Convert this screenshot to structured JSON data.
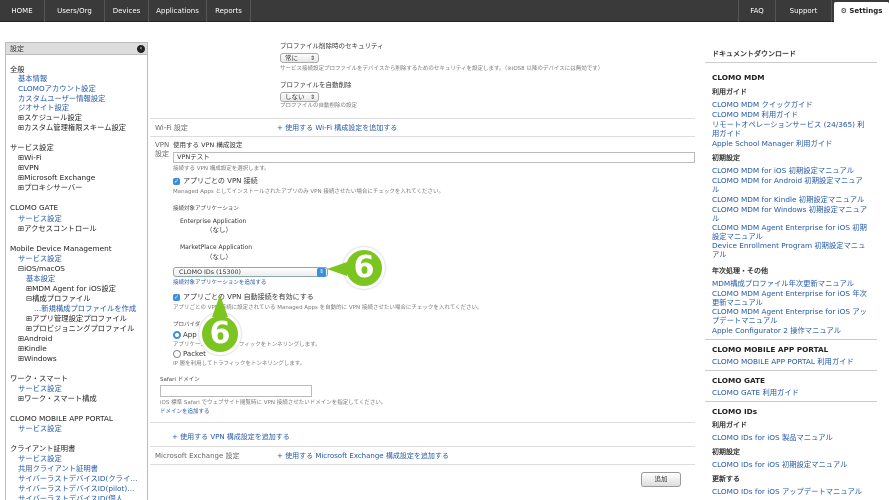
{
  "nav": {
    "home": "HOME",
    "users": "Users/Org",
    "devices": "Devices",
    "applications": "Applications",
    "reports": "Reports",
    "faq": "FAQ",
    "support": "Support",
    "settings": "Settings"
  },
  "sidebar": {
    "header": "設定",
    "items": [
      "全般",
      "基本情報",
      "CLOMOアカウント設定",
      "カスタムユーザー情報設定",
      "ジオサイト設定",
      "⊞スケジュール設定",
      "⊞カスタム管理権限スキーム設定",
      "サービス設定",
      "⊞Wi-Fi",
      "⊞VPN",
      "⊞Microsoft Exchange",
      "⊞プロキシサーバー",
      "CLOMO GATE",
      "サービス設定",
      "⊞アクセスコントロール",
      "Mobile Device Management",
      "サービス設定",
      "⊟iOS/macOS",
      "基本設定",
      "⊞MDM Agent for iOS設定",
      "⊟構成プロファイル",
      "…新規構成プロファイルを作成",
      "⊞アプリ管理設定プロファイル",
      "⊞プロビジョニングプロファイル",
      "⊞Android",
      "⊞Kindle",
      "⊞Windows",
      "ワーク・スマート",
      "サービス設定",
      "⊞ワーク・スマート構成",
      "CLOMO MOBILE APP PORTAL",
      "サービス設定",
      "クライアント証明書",
      "サービス設定",
      "共用クライアント証明書",
      "サイバーラストデバイスID(クライ…",
      "サイバーラストデバイスID(pilot)…",
      "サイバーラストデバイスID(個人…"
    ]
  },
  "main": {
    "removal_security_label": "プロファイル削除時のセキュリティ",
    "removal_security_value": "常に",
    "removal_security_note": "サービス接続設定プロファイルをデバイスから削除するためのセキュリティを設定します。（※iOS8 以降のデバイスには無効です）",
    "auto_remove_label": "プロファイルを自動削除",
    "auto_remove_value": "しない",
    "auto_remove_note": "プロファイルの自動削除の設定",
    "wifi_section": "Wi-Fi 設定",
    "wifi_add": "+ 使用する Wi-Fi 構成設定を追加する",
    "vpn_section": "VPN 設定",
    "vpn_config_label": "使用する VPN 構成設定",
    "vpn_config_value": "VPNテスト",
    "vpn_config_note": "接続する VPN 構成設定を選択します。",
    "per_app_vpn_label": "アプリごとの VPN 接続",
    "per_app_vpn_note": "Managed Apps としてインストールされたアプリのみ VPN 接続させたい場合にチェックを入れてください。",
    "target_apps_label": "接続対象アプリケーション",
    "enterprise_label": "Enterprise Application",
    "enterprise_value": "（なし）",
    "marketplace_label": "MarketPlace Application",
    "marketplace_value": "（なし）",
    "app_select_value": "CLOMO IDs (15300)",
    "add_target_app": "接続対象アプリケーションを追加する",
    "auto_connect_label": "アプリごとの VPN 自動接続を有効にする",
    "auto_connect_note": "アプリごとの VPN 接続に設定されている Managed Apps を自動的に VPN 接続させたい場合にチェックを入れてください。",
    "provider_label": "プロバイダ",
    "radio_app": "App",
    "radio_app_note": "アプリケーション層でトラフィックをトンネリングします。",
    "radio_packet": "Packet",
    "radio_packet_note": "IP 層を利用してトラフィックをトンネリングします。",
    "safari_label": "Safari ドメイン",
    "safari_note": "iOS 標準 Safari でウェブサイト閲覧時に VPN 接続させたいドメインを指定してください。",
    "add_domain": "ドメインを追加する",
    "vpn_add": "+ 使用する VPN 構成設定を追加する",
    "exchange_section": "Microsoft Exchange 設定",
    "exchange_add": "+ 使用する Microsoft Exchange 構成設定を追加する",
    "add_button": "追加"
  },
  "badges": {
    "top": "6",
    "bottom": "6"
  },
  "right": {
    "title": "ドキュメントダウンロード",
    "mdm": "CLOMO MDM",
    "usage_guide": "利用ガイド",
    "usage_links": [
      "CLOMO MDM クイックガイド",
      "CLOMO MDM 利用ガイド",
      "リモートオペレーションサービス (24/365) 利用ガイド",
      "Apple School Manager 利用ガイド"
    ],
    "initial": "初期設定",
    "initial_links": [
      "CLOMO MDM for iOS 初期設定マニュアル",
      "CLOMO MDM for Android 初期設定マニュアル",
      "CLOMO MDM for Kindle 初期設定マニュアル",
      "CLOMO MDM for Windows 初期設定マニュアル",
      "CLOMO MDM Agent Enterprise for iOS 初期設定マニュアル",
      "Device Enrollment Program 初期設定マニュアル"
    ],
    "yearly": "年次処理・その他",
    "yearly_links": [
      "MDM構成プロファイル年次更新マニュアル",
      "CLOMO MDM Agent Enterprise for iOS 年次更新マニュアル",
      "CLOMO MDM Agent Enterprise for iOS アップデートマニュアル",
      "Apple Configurator 2 操作マニュアル"
    ],
    "portal": "CLOMO MOBILE APP PORTAL",
    "portal_link": "CLOMO MOBILE APP PORTAL 利用ガイド",
    "gate": "CLOMO GATE",
    "gate_link": "CLOMO GATE 利用ガイド",
    "ids": "CLOMO IDs",
    "ids_usage": "利用ガイド",
    "ids_usage_link": "CLOMO IDs for iOS 製品マニュアル",
    "ids_initial": "初期設定",
    "ids_initial_link": "CLOMO IDs for iOS 初期設定マニュアル",
    "ids_update": "更新する",
    "ids_update_link": "CLOMO IDs for iOS アップデートマニュアル"
  }
}
